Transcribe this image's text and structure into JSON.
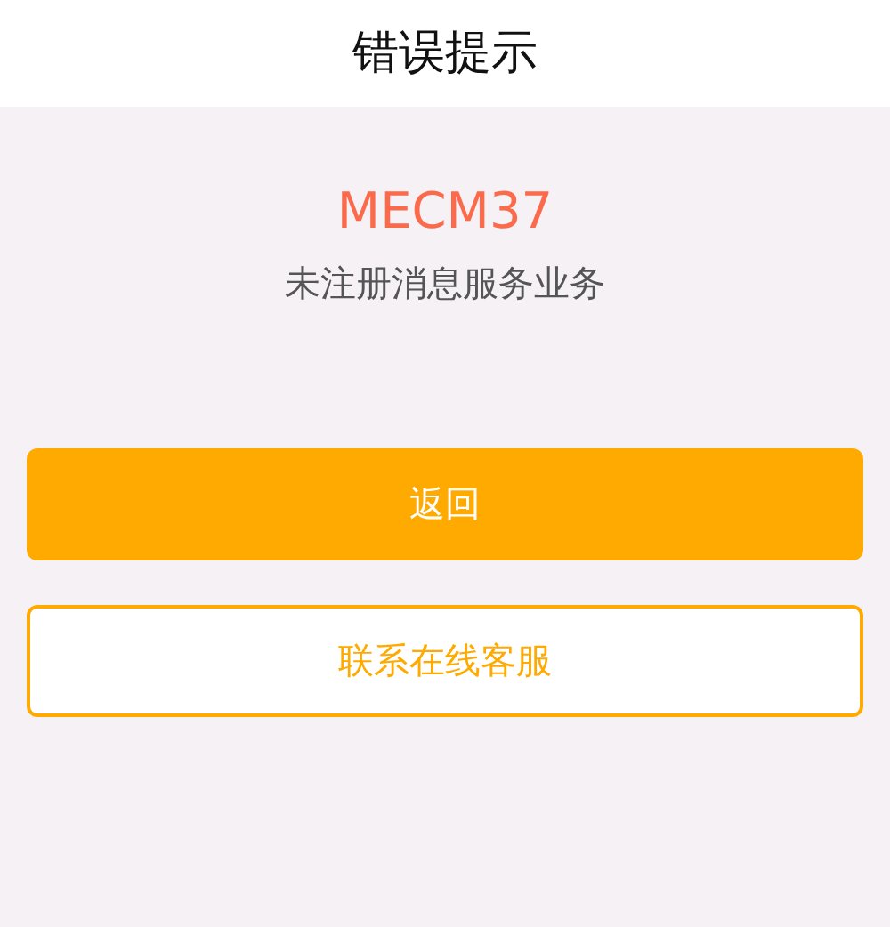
{
  "header": {
    "title": "错误提示"
  },
  "error": {
    "code": "MECM37",
    "message": "未注册消息服务业务"
  },
  "buttons": [
    {
      "label": "返回",
      "kind": "primary"
    },
    {
      "label": "联系在线客服",
      "kind": "outline"
    }
  ]
}
